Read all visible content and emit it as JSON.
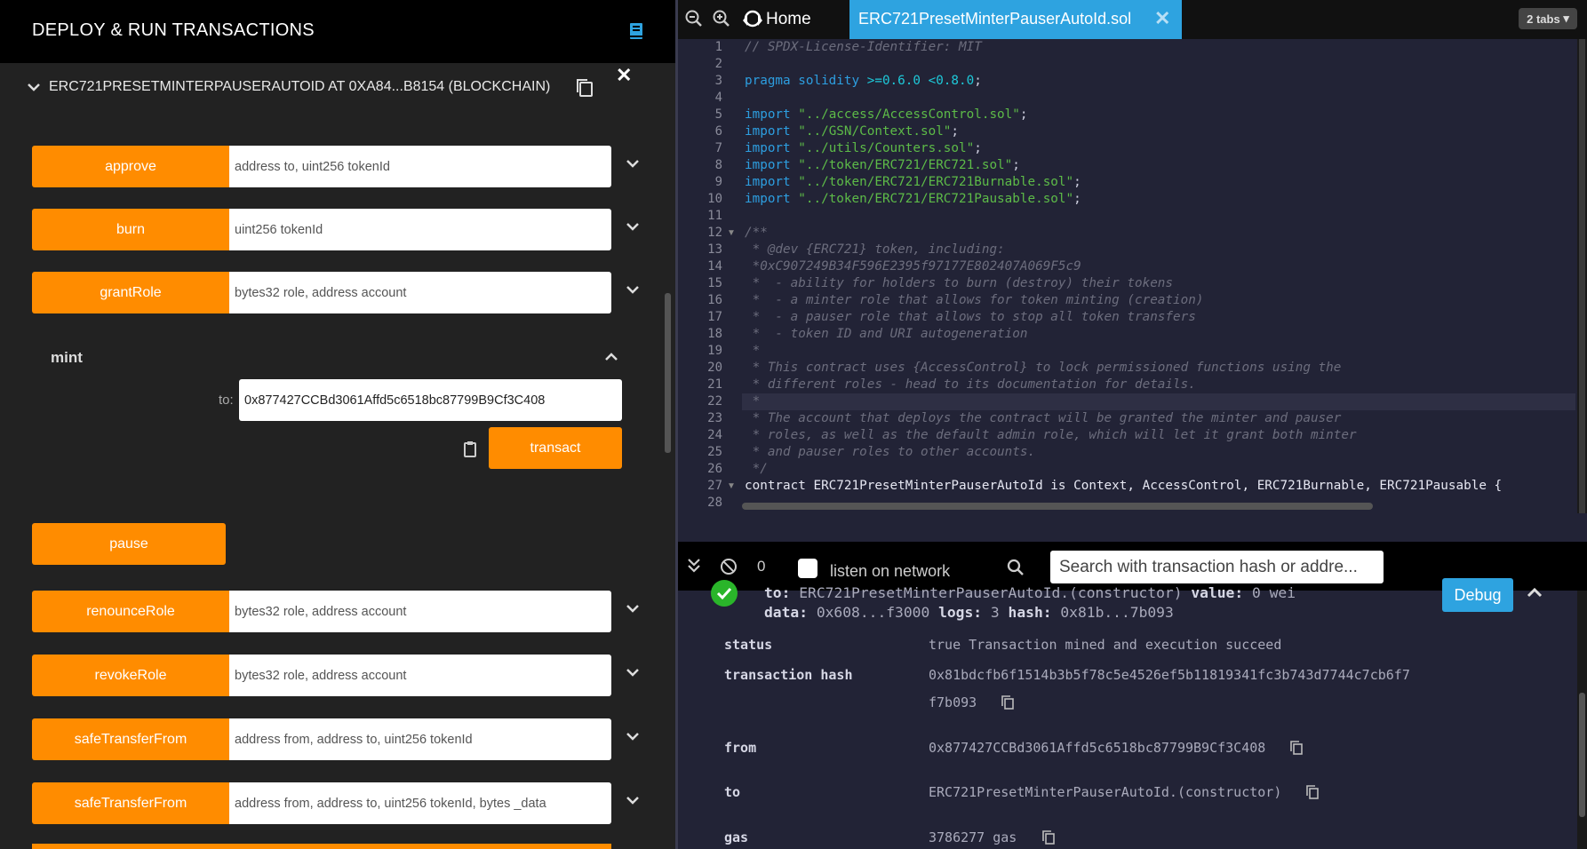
{
  "left_panel": {
    "title": "DEPLOY & RUN TRANSACTIONS",
    "contract_title": "ERC721PRESETMINTERPAUSERAUTOID AT 0XA84...B8154 (BLOCKCHAIN)",
    "functions": [
      {
        "name": "approve",
        "params": "address to, uint256 tokenId"
      },
      {
        "name": "burn",
        "params": "uint256 tokenId"
      },
      {
        "name": "grantRole",
        "params": "bytes32 role, address account"
      },
      {
        "name": "renounceRole",
        "params": "bytes32 role, address account"
      },
      {
        "name": "revokeRole",
        "params": "bytes32 role, address account"
      },
      {
        "name": "safeTransferFrom",
        "params": "address from, address to, uint256 tokenId"
      },
      {
        "name": "safeTransferFrom",
        "params": "address from, address to, uint256 tokenId, bytes _data"
      }
    ],
    "mint": {
      "label": "mint",
      "to_label": "to:",
      "to_value": "0x877427CCBd3061Affd5c6518bc87799B9Cf3C408",
      "transact_label": "transact"
    },
    "pause_label": "pause"
  },
  "tabbar": {
    "home_label": "Home",
    "file_tab": "ERC721PresetMinterPauserAutoId.sol",
    "tabs_count": "2 tabs"
  },
  "editor": {
    "lines": [
      "1",
      "2",
      "3",
      "4",
      "5",
      "6",
      "7",
      "8",
      "9",
      "10",
      "11",
      "12",
      "13",
      "14",
      "15",
      "16",
      "17",
      "18",
      "19",
      "20",
      "21",
      "22",
      "23",
      "24",
      "25",
      "26",
      "27",
      "28"
    ],
    "code": {
      "l1": "// SPDX-License-Identifier: MIT",
      "l3_kw": "pragma solidity",
      "l3_ver": ">=0.6.0 <0.8.0",
      "l3_end": ";",
      "import_kw": "import",
      "l5": "\"../access/AccessControl.sol\"",
      "l6": "\"../GSN/Context.sol\"",
      "l7": "\"../utils/Counters.sol\"",
      "l8": "\"../token/ERC721/ERC721.sol\"",
      "l9": "\"../token/ERC721/ERC721Burnable.sol\"",
      "l10": "\"../token/ERC721/ERC721Pausable.sol\"",
      "semi": ";",
      "l12": "/**",
      "l13": " * @dev {ERC721} token, including:",
      "l14": " *0xC907249B34F596E2395f97177E802407A069F5c9",
      "l15": " *  - ability for holders to burn (destroy) their tokens",
      "l16": " *  - a minter role that allows for token minting (creation)",
      "l17": " *  - a pauser role that allows to stop all token transfers",
      "l18": " *  - token ID and URI autogeneration",
      "l19": " *",
      "l20": " * This contract uses {AccessControl} to lock permissioned functions using the",
      "l21": " * different roles - head to its documentation for details.",
      "l22": " *",
      "l23": " * The account that deploys the contract will be granted the minter and pauser",
      "l24": " * roles, as well as the default admin role, which will let it grant both minter",
      "l25": " * and pauser roles to other accounts.",
      "l26": " */",
      "l27": "contract ERC721PresetMinterPauserAutoId is Context, AccessControl, ERC721Burnable, ERC721Pausable {"
    }
  },
  "terminal_bar": {
    "count": "0",
    "listen_label": "listen on network",
    "search_placeholder": "Search with transaction hash or addre..."
  },
  "terminal": {
    "summary_line1_to_label": "to:",
    "summary_line1_to_value": "ERC721PresetMinterPauserAutoId.(constructor)",
    "summary_line1_value_label": "value:",
    "summary_line1_value": "0 wei",
    "summary_line2_data_label": "data:",
    "summary_line2_data": "0x608...f3000",
    "summary_line2_logs_label": "logs:",
    "summary_line2_logs": "3",
    "summary_line2_hash_label": "hash:",
    "summary_line2_hash": "0x81b...7b093",
    "debug_label": "Debug",
    "rows": [
      {
        "key": "status",
        "value": "true Transaction mined and execution succeed"
      },
      {
        "key": "transaction hash",
        "value": "0x81bdcfb6f1514b3b5f78c5e4526ef5b11819341fc3b743d7744c7cb6f7",
        "value2": "f7b093"
      },
      {
        "key": "from",
        "value": "0x877427CCBd3061Affd5c6518bc87799B9Cf3C408"
      },
      {
        "key": "to",
        "value": "ERC721PresetMinterPauserAutoId.(constructor)"
      },
      {
        "key": "gas",
        "value": "3786277 gas"
      }
    ]
  },
  "colors": {
    "accent_orange": "#ff8c00",
    "accent_blue": "#2ea3e0",
    "success_green": "#2ab52a"
  }
}
